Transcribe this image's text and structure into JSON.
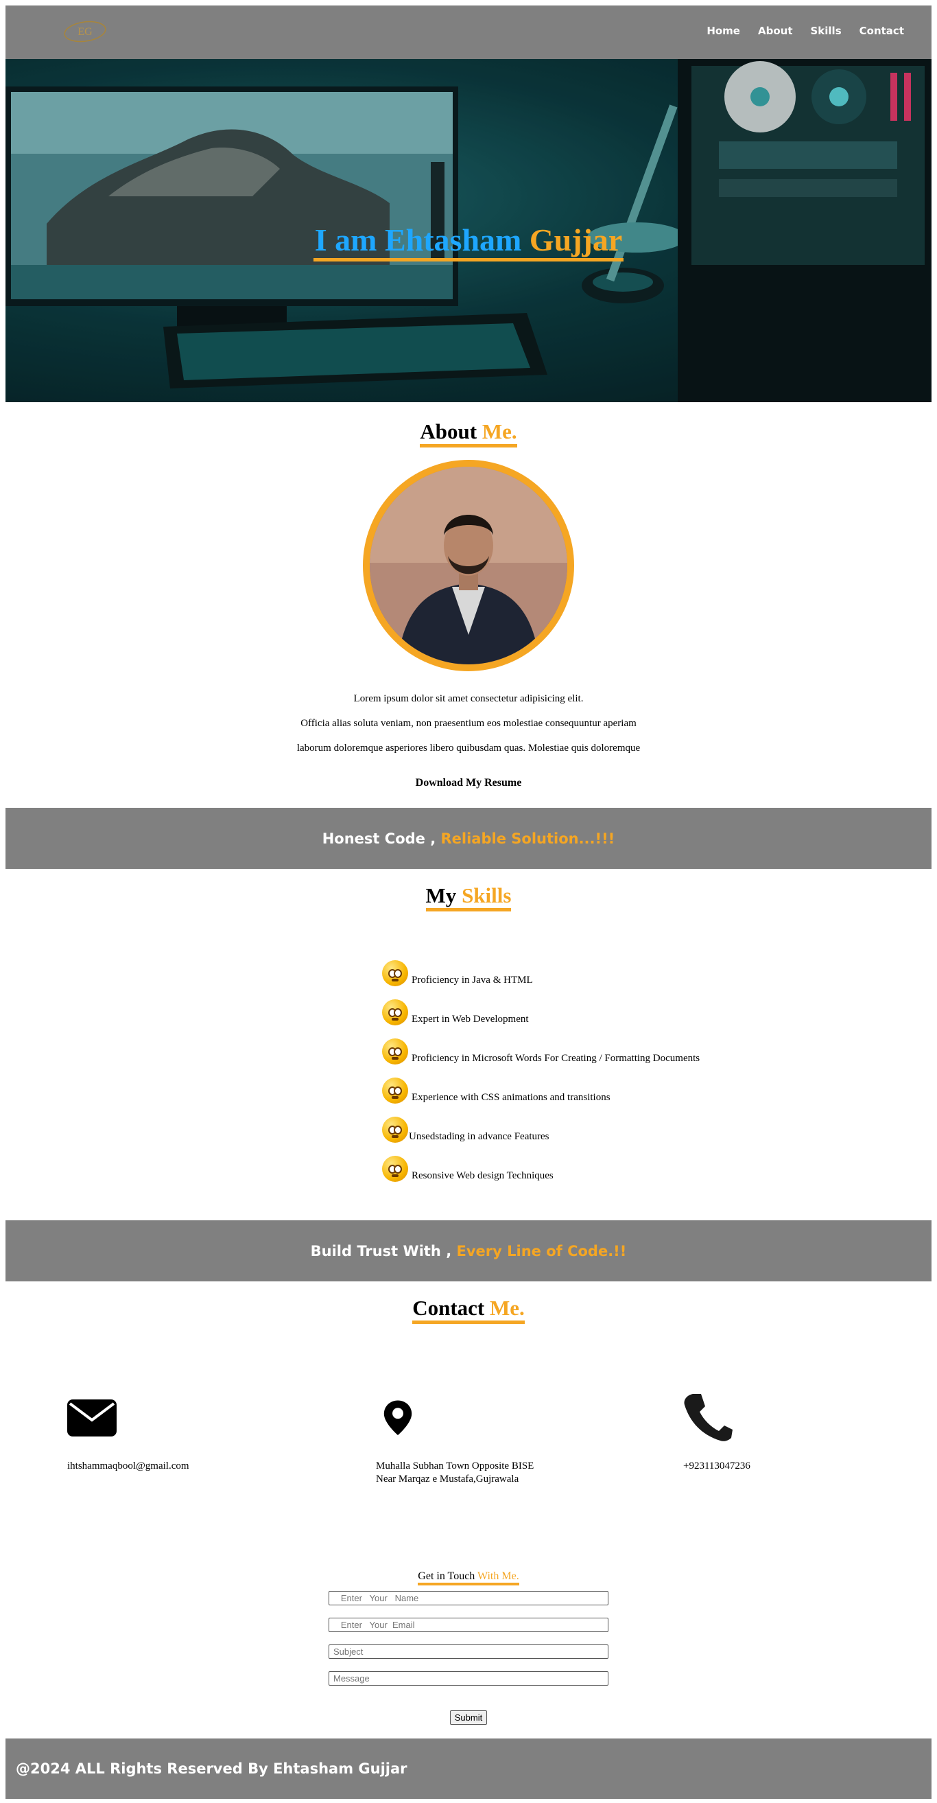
{
  "nav": {
    "logo_text": "EG",
    "links": [
      "Home",
      "About",
      "Skills",
      "Contact"
    ]
  },
  "hero": {
    "title_part1": "I am Ehtasham",
    "title_part2": "Gujjar"
  },
  "about": {
    "title_part1": "About",
    "title_part2": "Me.",
    "lines": [
      "Lorem ipsum dolor sit amet consectetur adipisicing elit.",
      "Officia alias soluta veniam, non praesentium eos molestiae consequuntur aperiam",
      "laborum doloremque asperiores libero quibusdam quas. Molestiae quis doloremque"
    ],
    "resume_label": "Download My Resume"
  },
  "band1": {
    "part1": "Honest Code ,",
    "part2": "Reliable Solution...!!!"
  },
  "skills": {
    "title_part1": "My",
    "title_part2": "Skills",
    "items": [
      "Proficiency in Java & HTML",
      "Expert in Web Development",
      "Proficiency in Microsoft Words For Creating / Formatting Documents",
      "Experience with CSS animations and transitions",
      "Unsedstading in advance Features",
      "Resonsive Web design Techniques"
    ]
  },
  "band2": {
    "part1": "Build Trust With ,",
    "part2": "Every Line of Code.!!"
  },
  "contact": {
    "title_part1": "Contact",
    "title_part2": "Me.",
    "email": "ihtshammaqbool@gmail.com",
    "address_line1": "Muhalla Subhan Town Opposite BISE",
    "address_line2": "Near Marqaz e Mustafa,Gujrawala",
    "phone": "+923113047236",
    "icons": [
      "envelope-icon",
      "location-pin-icon",
      "phone-icon"
    ]
  },
  "form": {
    "title_part1": "Get in Touch",
    "title_part2": "With Me.",
    "name_placeholder": "   Enter   Your   Name",
    "email_placeholder": "   Enter   Your  Email",
    "subject_placeholder": "Subject",
    "message_placeholder": "Message",
    "submit_label": "Submit"
  },
  "footer": {
    "text": "@2024 ALL Rights Reserved By Ehtasham Gujjar"
  },
  "colors": {
    "accent": "#f5a623",
    "hero_blue": "#1ea7ff",
    "band_gray": "#808080"
  }
}
